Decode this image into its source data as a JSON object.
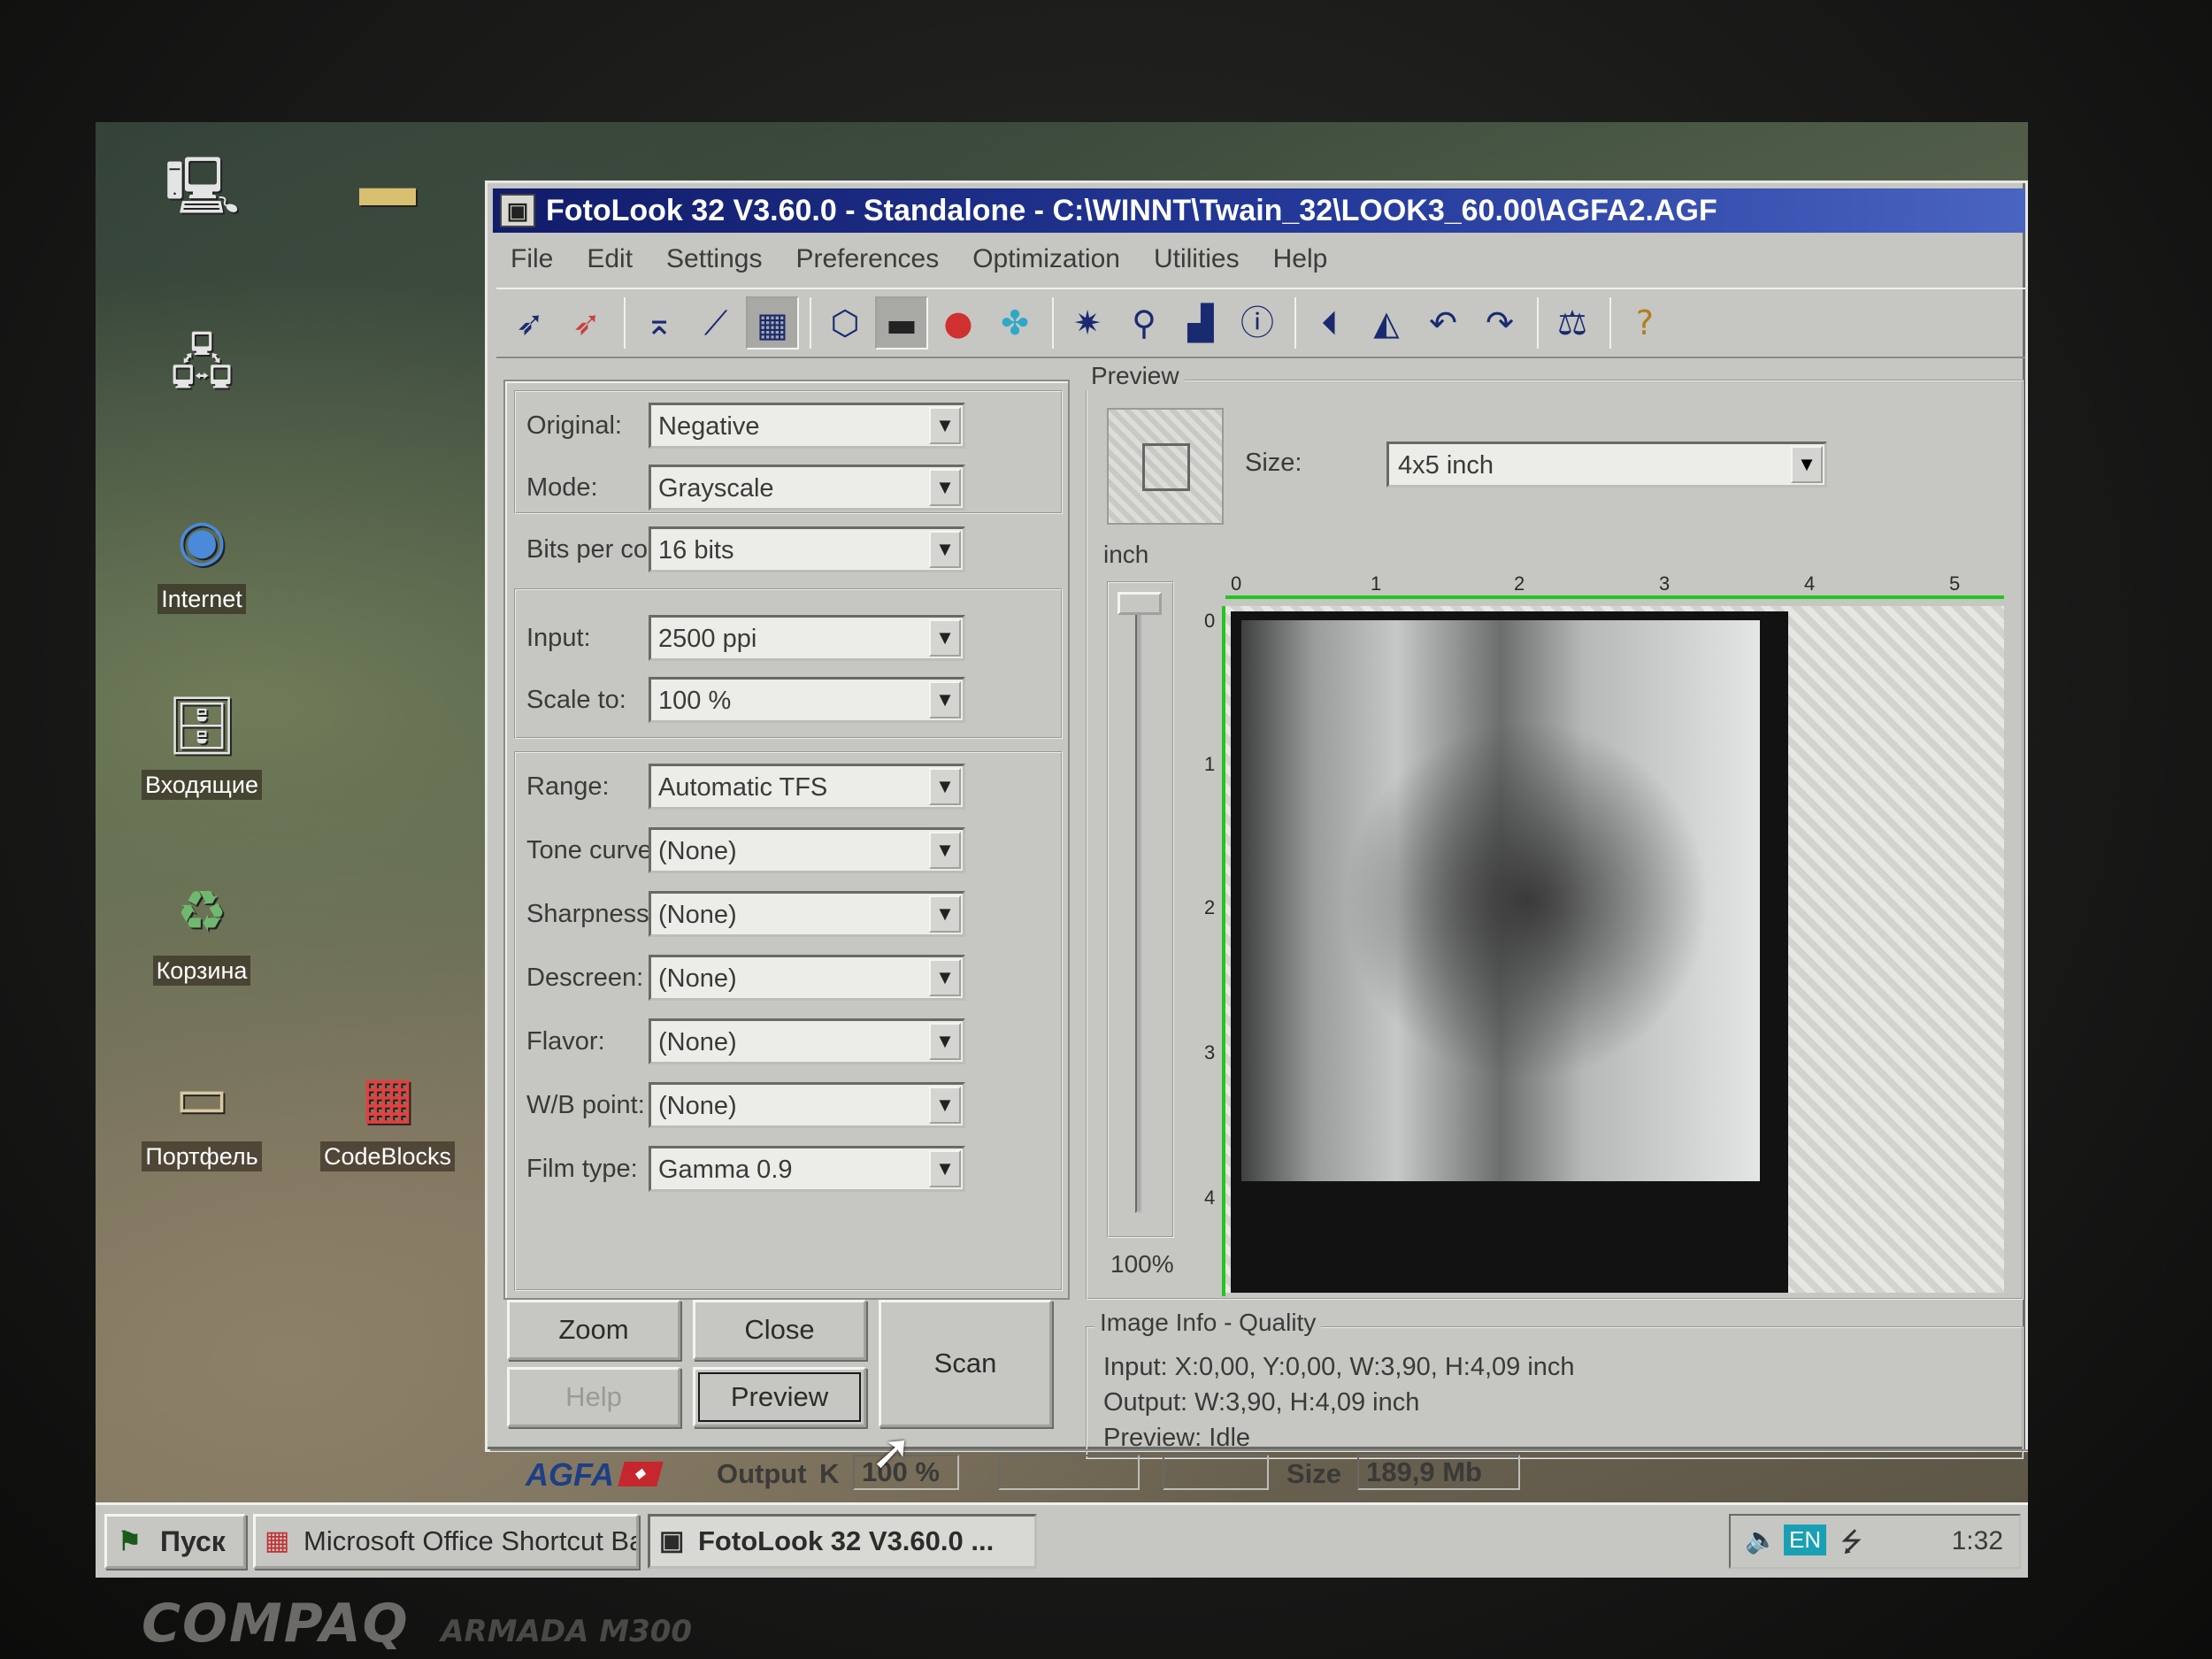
{
  "desktop": {
    "icons": [
      {
        "label": "",
        "glyph": "computer-icon"
      },
      {
        "label": "",
        "glyph": "folder-icon"
      },
      {
        "label": "",
        "glyph": "network-icon"
      },
      {
        "label": "Internet",
        "glyph": "internet-globe-icon"
      },
      {
        "label": "Входящие",
        "glyph": "inbox-icon"
      },
      {
        "label": "Корзина",
        "glyph": "recycle-bin-icon"
      },
      {
        "label": "Портфель",
        "glyph": "briefcase-icon"
      },
      {
        "label": "CodeBlocks",
        "glyph": "codeblocks-icon"
      }
    ]
  },
  "window": {
    "title": "FotoLook 32 V3.60.0 - Standalone - C:\\WINNT\\Twain_32\\LOOK3_60.00\\AGFA2.AGF",
    "menu": [
      "File",
      "Edit",
      "Settings",
      "Preferences",
      "Optimization",
      "Utilities",
      "Help"
    ],
    "toolbar_icons": [
      "prescan-icon",
      "color-prescan-icon",
      "crop-auto-icon",
      "crop-manual-icon",
      "grid-icon",
      "shape-icon",
      "grayscale-icon",
      "rgb-icon",
      "cmyk-icon",
      "sparkle-icon",
      "pin-icon",
      "histogram-icon",
      "info-icon",
      "flip-icon",
      "mirror-icon",
      "rotate-left-icon",
      "rotate-right-icon",
      "balance-icon",
      "help-agent-icon"
    ]
  },
  "settings": {
    "original": {
      "label": "Original:",
      "value": "Negative"
    },
    "mode": {
      "label": "Mode:",
      "value": "Grayscale"
    },
    "bits": {
      "label": "Bits per color:",
      "value": "16 bits"
    },
    "input": {
      "label": "Input:",
      "value": "2500 ppi"
    },
    "scale": {
      "label": "Scale to:",
      "value": "100 %"
    },
    "range": {
      "label": "Range:",
      "value": "Automatic TFS"
    },
    "tone": {
      "label": "Tone curve:",
      "value": "(None)"
    },
    "sharpness": {
      "label": "Sharpness:",
      "value": "(None)"
    },
    "descreen": {
      "label": "Descreen:",
      "value": "(None)"
    },
    "flavor": {
      "label": "Flavor:",
      "value": "(None)"
    },
    "wb": {
      "label": "W/B point:",
      "value": "(None)"
    },
    "film": {
      "label": "Film type:",
      "value": "Gamma 0.9"
    }
  },
  "buttons": {
    "zoom": "Zoom",
    "close": "Close",
    "scan": "Scan",
    "help": "Help",
    "preview": "Preview"
  },
  "preview": {
    "legend": "Preview",
    "size_label": "Size:",
    "size_value": "4x5 inch",
    "unit": "inch",
    "zoom": "100%",
    "ruler_x": [
      "0",
      "1",
      "2",
      "3",
      "4",
      "5"
    ],
    "ruler_y": [
      "0",
      "1",
      "2",
      "3",
      "4"
    ]
  },
  "info": {
    "legend": "Image Info - Quality",
    "input": "Input: X:0,00, Y:0,00, W:3,90, H:4,09 inch",
    "output": "Output: W:3,90, H:4,09 inch",
    "preview": "Preview: Idle"
  },
  "status": {
    "brand": "AGFA",
    "output_label": "Output",
    "output_channel": "K",
    "output_value": "100 %",
    "size_label": "Size",
    "size_value": "189,9 Mb"
  },
  "taskbar": {
    "start": "Пуск",
    "tasks": [
      "Microsoft Office Shortcut Bar",
      "FotoLook 32 V3.60.0 ..."
    ],
    "lang": "EN",
    "clock": "1:32"
  },
  "bezel": {
    "brand": "COMPAQ",
    "model": "ARMADA M300"
  }
}
